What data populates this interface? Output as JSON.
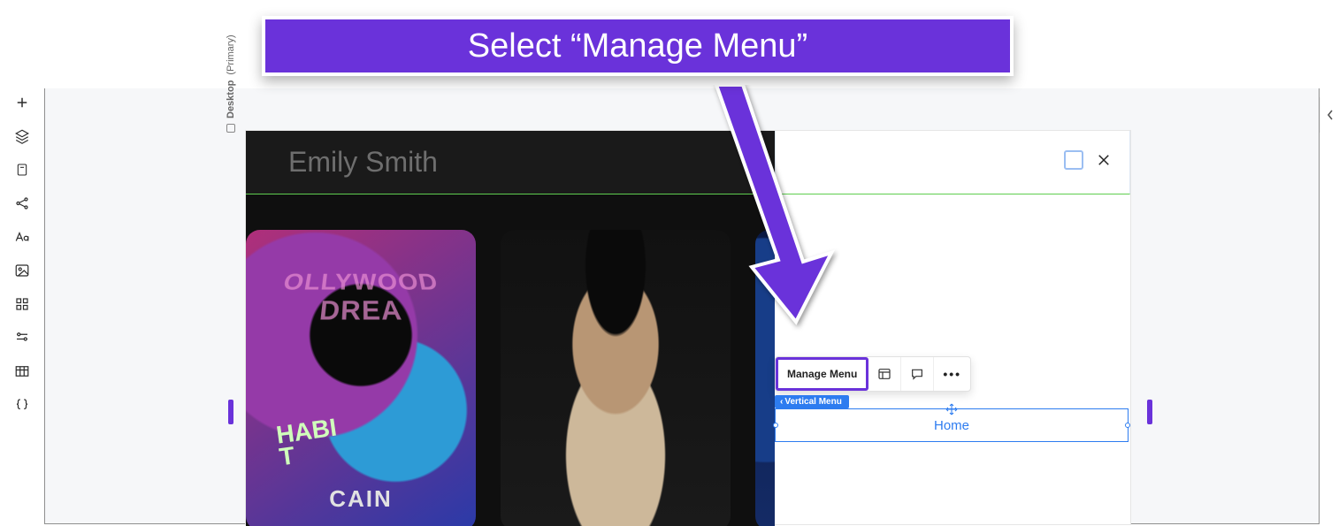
{
  "banner": {
    "text": "Select “Manage Menu”"
  },
  "viewport": {
    "label": "Desktop",
    "suffix": "(Primary)"
  },
  "site": {
    "title": "Emily Smith"
  },
  "cards": {
    "p1": {
      "arch": "OLLYWOOD DREA",
      "badge1": "HABI",
      "badge2": "T",
      "name": "CAIN"
    }
  },
  "toolbar": {
    "manage_label": "Manage Menu",
    "more_dots": "•••"
  },
  "element_tag": {
    "label": "Vertical Menu",
    "chevron": "‹"
  },
  "selected": {
    "label": "Home"
  },
  "icons": {
    "plus": "plus-icon",
    "layers": "layers-icon",
    "page": "page-icon",
    "share": "share-icon",
    "font": "font-icon",
    "image": "image-icon",
    "grid": "grid-icon",
    "sliders": "sliders-icon",
    "table": "table-icon",
    "braces": "braces-icon"
  }
}
